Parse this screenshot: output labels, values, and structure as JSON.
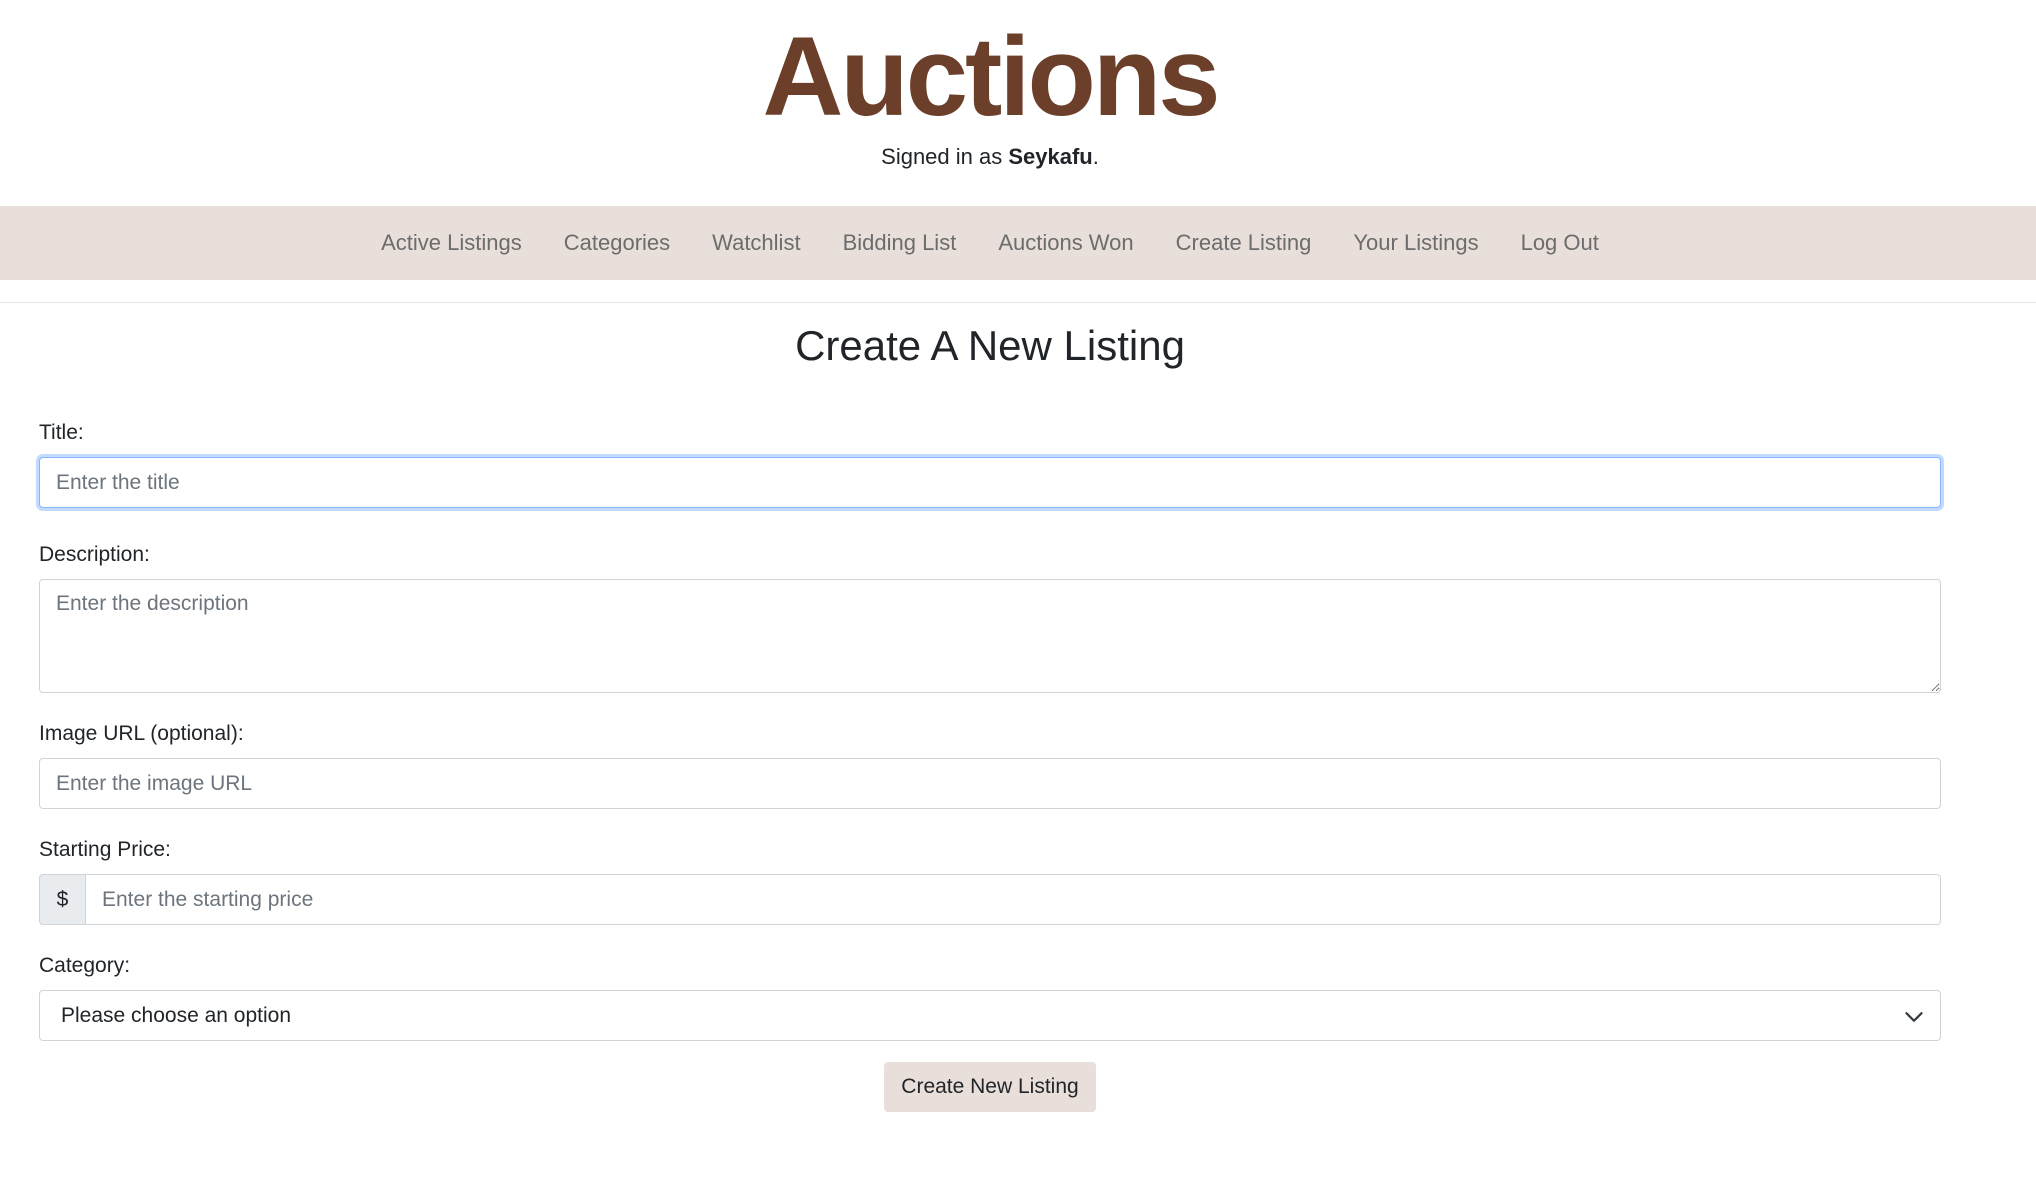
{
  "header": {
    "site_title": "Auctions",
    "signed_in_prefix": "Signed in as ",
    "username": "Seykafu",
    "signed_in_suffix": "."
  },
  "nav": {
    "items": [
      {
        "label": "Active Listings"
      },
      {
        "label": "Categories"
      },
      {
        "label": "Watchlist"
      },
      {
        "label": "Bidding List"
      },
      {
        "label": "Auctions Won"
      },
      {
        "label": "Create Listing"
      },
      {
        "label": "Your Listings"
      },
      {
        "label": "Log Out"
      }
    ]
  },
  "form": {
    "heading": "Create A New Listing",
    "title": {
      "label": "Title:",
      "placeholder": "Enter the title",
      "value": ""
    },
    "description": {
      "label": "Description:",
      "placeholder": "Enter the description",
      "value": ""
    },
    "image_url": {
      "label": "Image URL (optional):",
      "placeholder": "Enter the image URL",
      "value": ""
    },
    "starting_price": {
      "label": "Starting Price:",
      "prefix": "$",
      "placeholder": "Enter the starting price",
      "value": ""
    },
    "category": {
      "label": "Category:",
      "selected": "Please choose an option"
    },
    "submit_label": "Create New Listing"
  },
  "colors": {
    "brand": "#6b3f2a",
    "nav_background": "#e8dfdb",
    "focus_border": "#86b7fe"
  }
}
